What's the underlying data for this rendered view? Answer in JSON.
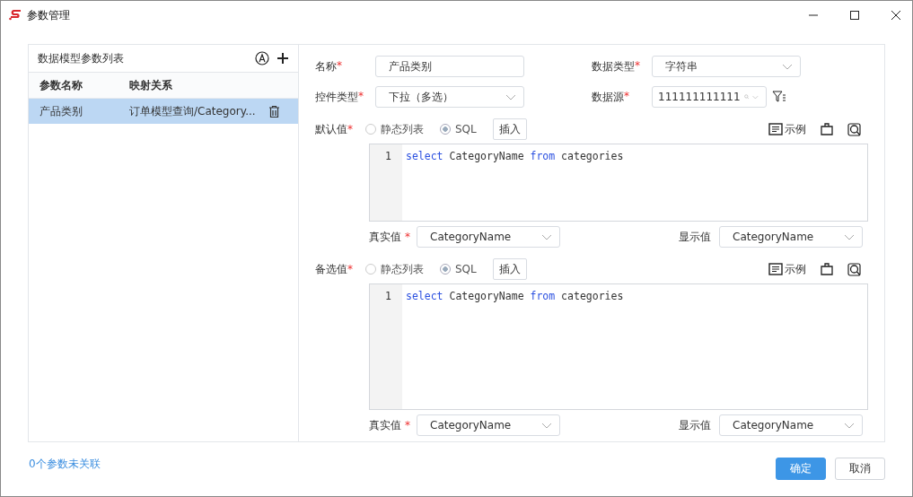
{
  "window": {
    "title": "参数管理"
  },
  "param_list": {
    "title": "数据模型参数列表",
    "columns": [
      "参数名称",
      "映射关系"
    ],
    "rows": [
      {
        "name": "产品类别",
        "mapping": "订单模型查询/Category...",
        "selected": true
      }
    ]
  },
  "form": {
    "name": {
      "label": "名称",
      "mark": "*",
      "value": "产品类别"
    },
    "data_type": {
      "label": "数据类型",
      "mark": "*",
      "value": "字符串"
    },
    "control_type": {
      "label": "控件类型",
      "mark": "*",
      "value": "下拉（多选）"
    },
    "data_source": {
      "label": "数据源",
      "mark": "*",
      "value": "111111111111"
    },
    "sections": [
      {
        "label": "默认值",
        "mark": "*",
        "options": [
          {
            "label": "静态列表",
            "selected": false
          },
          {
            "label": "SQL",
            "selected": true
          }
        ],
        "insert": "插入",
        "example": "示例",
        "code": [
          {
            "number": "1",
            "tokens": [
              {
                "text": "select",
                "kind": "keyword"
              },
              {
                "text": " CategoryName ",
                "kind": "plain"
              },
              {
                "text": "from",
                "kind": "keyword"
              },
              {
                "text": " categories",
                "kind": "plain"
              }
            ]
          }
        ],
        "real": {
          "label": "真实值",
          "mark": "*",
          "value": "CategoryName"
        },
        "display": {
          "label": "显示值",
          "value": "CategoryName"
        }
      },
      {
        "label": "备选值",
        "mark": "*",
        "options": [
          {
            "label": "静态列表",
            "selected": false
          },
          {
            "label": "SQL",
            "selected": true
          }
        ],
        "insert": "插入",
        "example": "示例",
        "code": [
          {
            "number": "1",
            "tokens": [
              {
                "text": "select",
                "kind": "keyword"
              },
              {
                "text": " CategoryName ",
                "kind": "plain"
              },
              {
                "text": "from",
                "kind": "keyword"
              },
              {
                "text": " categories",
                "kind": "plain"
              }
            ]
          }
        ],
        "real": {
          "label": "真实值",
          "mark": "*",
          "value": "CategoryName"
        },
        "display": {
          "label": "显示值",
          "value": "CategoryName"
        }
      }
    ]
  },
  "footer": {
    "link": "0个参数未关联",
    "buttons": [
      {
        "label": "确定",
        "kind": "primary"
      },
      {
        "label": "取消",
        "kind": "default"
      }
    ]
  }
}
